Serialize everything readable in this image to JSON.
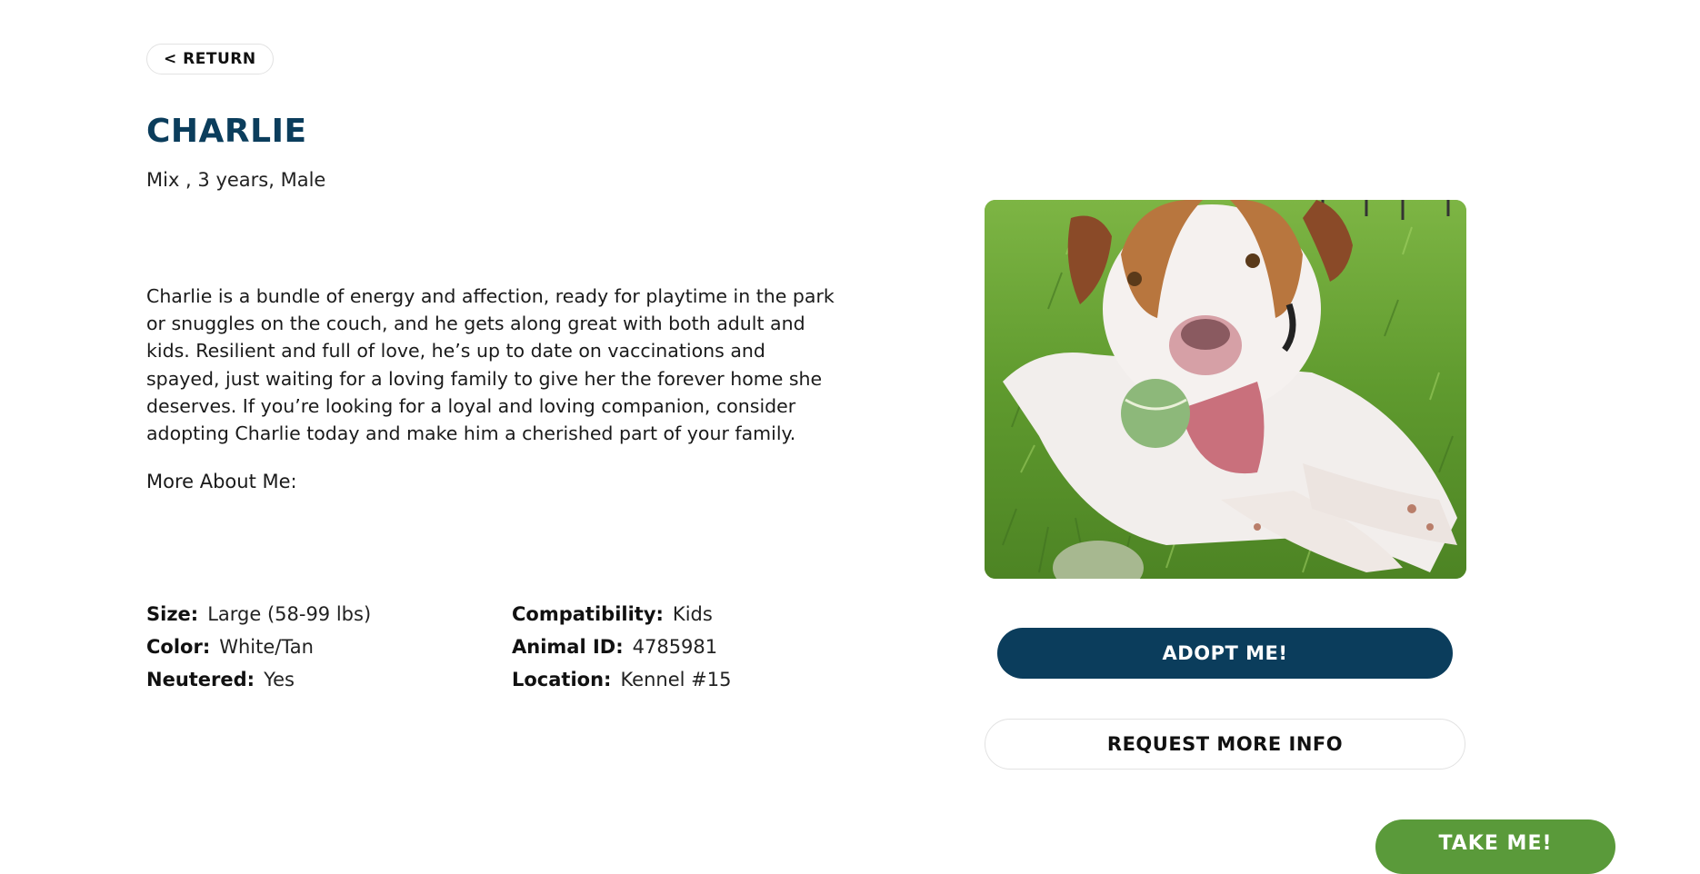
{
  "nav": {
    "return_label": "< RETURN"
  },
  "pet": {
    "name": "CHARLIE",
    "meta": "Mix ,  3 years, Male",
    "description": "Charlie is a bundle of energy and affection, ready for playtime in the park or snuggles on the couch, and he gets along great with both adult and kids. Resilient and full of love, he’s up to date on vaccinations and spayed, just waiting for a loving family to give her the forever home she deserves. If you’re looking for a loyal and loving companion, consider adopting Charlie today and make him a cherished part of your family.",
    "more_about_label": "More About Me:",
    "details": {
      "size_label": "Size:",
      "size_value": "Large (58-99 lbs)",
      "compatibility_label": "Compatibility:",
      "compatibility_value": "Kids",
      "color_label": "Color:",
      "color_value": "White/Tan",
      "animal_id_label": "Animal ID:",
      "animal_id_value": "4785981",
      "neutered_label": "Neutered:",
      "neutered_value": "Yes",
      "location_label": "Location:",
      "location_value": "Kennel #15"
    },
    "photo_icon": "dog-photo"
  },
  "actions": {
    "adopt_label": "ADOPT ME!",
    "request_info_label": "REQUEST MORE INFO",
    "floating_label": "TAKE ME!"
  },
  "colors": {
    "primary": "#0b3d5c",
    "accent_green": "#5a9a3a",
    "border": "#e2e2e2"
  }
}
